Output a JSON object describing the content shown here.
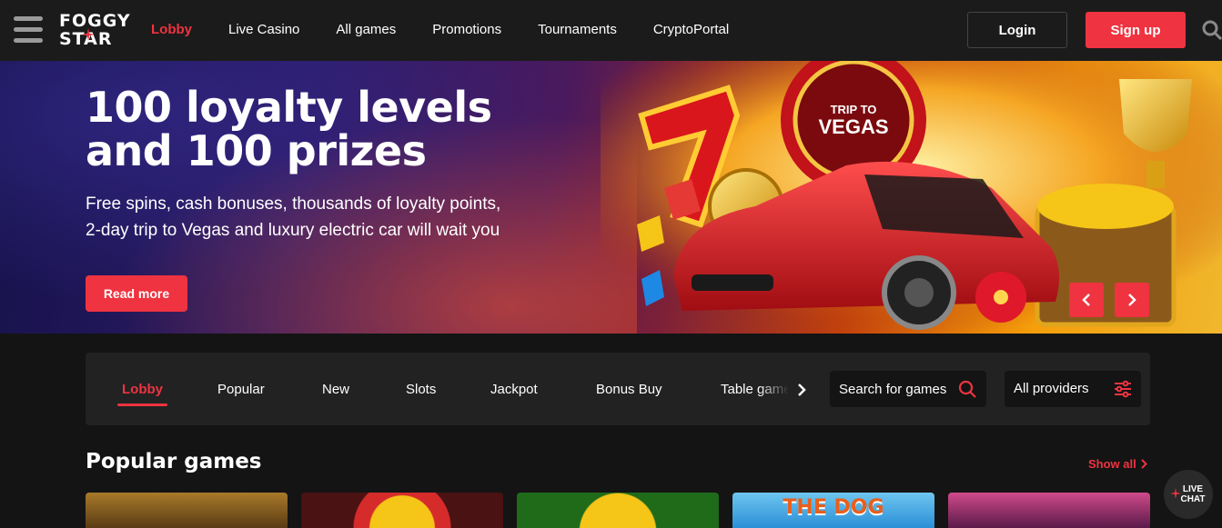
{
  "header": {
    "logo_line1": "FOGGY",
    "logo_line2": "STAR",
    "nav": [
      {
        "label": "Lobby",
        "active": true
      },
      {
        "label": "Live Casino"
      },
      {
        "label": "All games"
      },
      {
        "label": "Promotions"
      },
      {
        "label": "Tournaments"
      },
      {
        "label": "CryptoPortal"
      }
    ],
    "login_label": "Login",
    "signup_label": "Sign up"
  },
  "hero": {
    "title_line1": "100 loyalty levels",
    "title_line2": "and 100 prizes",
    "subtitle_line1": "Free spins, cash bonuses, thousands of loyalty points,",
    "subtitle_line2": "2-day trip to Vegas and luxury electric car will wait you",
    "cta_label": "Read more",
    "badge_line1": "TRIP TO",
    "badge_line2": "VEGAS"
  },
  "categories": {
    "items": [
      {
        "label": "Lobby",
        "active": true
      },
      {
        "label": "Popular"
      },
      {
        "label": "New"
      },
      {
        "label": "Slots"
      },
      {
        "label": "Jackpot"
      },
      {
        "label": "Bonus Buy"
      },
      {
        "label": "Table games"
      }
    ],
    "search_placeholder": "Search for games",
    "providers_label": "All providers"
  },
  "popular": {
    "title": "Popular games",
    "show_all": "Show all",
    "tiles": [
      {
        "label": ""
      },
      {
        "label": ""
      },
      {
        "label": ""
      },
      {
        "label": "THE DOG"
      },
      {
        "label": ""
      }
    ]
  },
  "live_chat": {
    "line1": "LIVE",
    "line2": "CHAT"
  },
  "colors": {
    "accent": "#ef3340",
    "background": "#141414",
    "header": "#1b1b1b",
    "panel": "#222222"
  }
}
